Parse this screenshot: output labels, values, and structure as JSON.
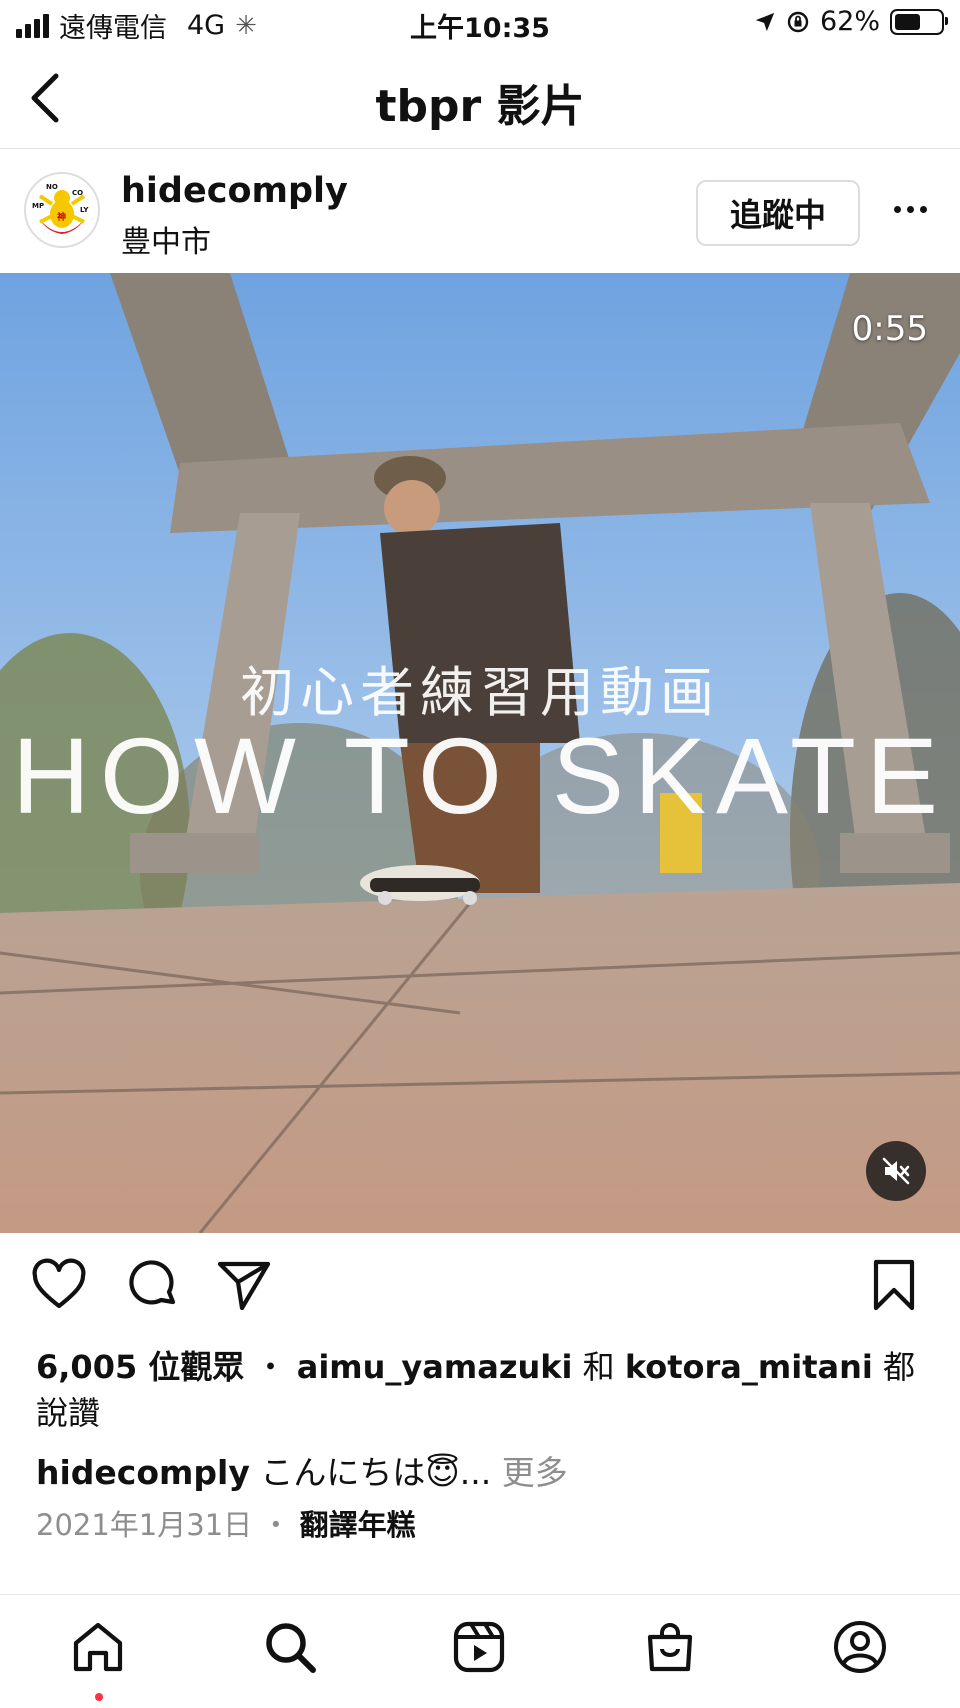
{
  "status_bar": {
    "carrier": "遠傳電信",
    "network": "4G",
    "time": "上午10:35",
    "battery_percent": "62%",
    "battery_level": 0.62
  },
  "header": {
    "title": "tbpr 影片"
  },
  "post": {
    "username": "hidecomply",
    "location": "豊中市",
    "follow_label": "追蹤中",
    "avatar_text": [
      "NO",
      "CO",
      "MP",
      "LY",
      "神"
    ]
  },
  "video": {
    "duration": "0:55",
    "overlay_subtitle": "初心者練習用動画",
    "overlay_title": "HOW TO SKATE"
  },
  "engagement": {
    "views": "6,005 位觀眾",
    "separator": "・",
    "liker1": "aimu_yamazuki",
    "and_word": "和",
    "liker2": "kotora_mitani",
    "suffix": "都說讚"
  },
  "caption": {
    "username": "hidecomply",
    "text": "こんにちは😇...",
    "more": "更多"
  },
  "meta": {
    "date": "2021年1月31日",
    "separator": "・",
    "translate": "翻譯年糕"
  },
  "colors": {
    "notification_dot": "#ff3040",
    "secondary_text": "#8e8e8e",
    "sky_top": "#7fb0e6",
    "ground": "#c8a48f"
  }
}
